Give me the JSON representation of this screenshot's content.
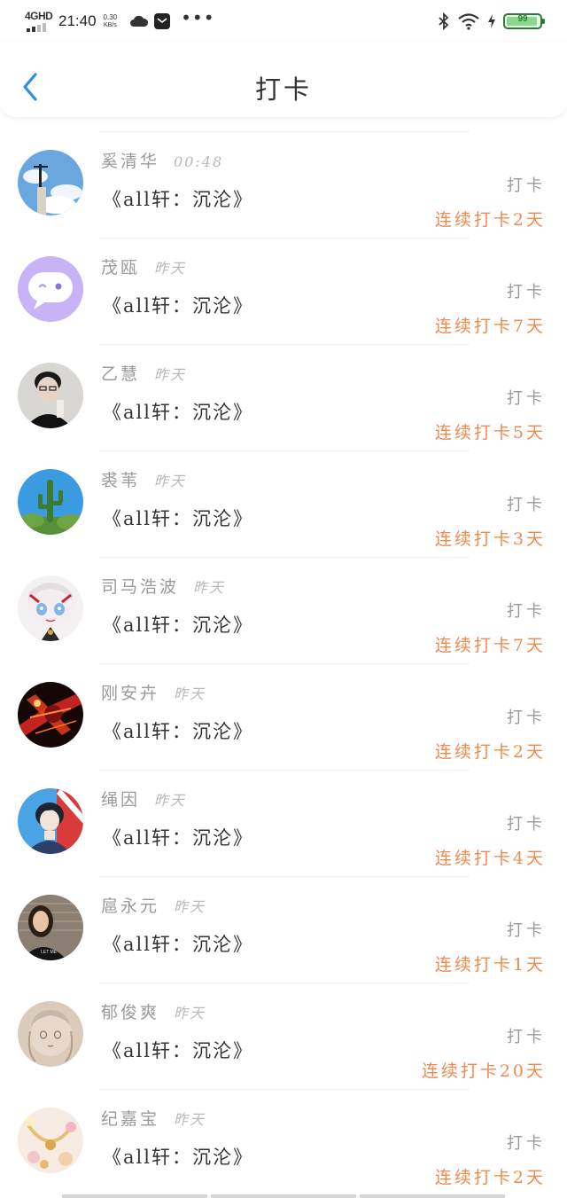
{
  "status_bar": {
    "network": "4GHD",
    "time": "21:40",
    "speed_value": "0.30",
    "speed_unit": "KB/s",
    "battery_text": "99",
    "battery_level": 0.99,
    "icons": [
      "weather-cloud-icon",
      "mail-icon",
      "more-dots-icon",
      "bluetooth-icon",
      "wifi-icon",
      "charging-icon",
      "battery-icon"
    ]
  },
  "header": {
    "title": "打卡",
    "back_icon": "chevron-left-icon"
  },
  "colors": {
    "accent_blue": "#2f8ee0",
    "streak_orange": "#ef8a4f",
    "muted_text": "#9a9a9a"
  },
  "entries": [
    {
      "name": "奚清华",
      "time": "00:48",
      "book": "《all轩：沉沦》",
      "action": "打卡",
      "streak": "连续打卡2天",
      "avatar": "sky-statue-avatar"
    },
    {
      "name": "茂瓯",
      "time": "昨天",
      "book": "《all轩：沉沦》",
      "action": "打卡",
      "streak": "连续打卡7天",
      "avatar": "purple-chat-avatar"
    },
    {
      "name": "乙慧",
      "time": "昨天",
      "book": "《all轩：沉沦》",
      "action": "打卡",
      "streak": "连续打卡5天",
      "avatar": "man-glasses-avatar"
    },
    {
      "name": "裘苇",
      "time": "昨天",
      "book": "《all轩：沉沦》",
      "action": "打卡",
      "streak": "连续打卡3天",
      "avatar": "cactus-avatar"
    },
    {
      "name": "司马浩波",
      "time": "昨天",
      "book": "《all轩：沉沦》",
      "action": "打卡",
      "streak": "连续打卡7天",
      "avatar": "anime-chibi-avatar"
    },
    {
      "name": "刚安卉",
      "time": "昨天",
      "book": "《all轩：沉沦》",
      "action": "打卡",
      "streak": "连续打卡2天",
      "avatar": "red-dark-art-avatar"
    },
    {
      "name": "绳因",
      "time": "昨天",
      "book": "《all轩：沉沦》",
      "action": "打卡",
      "streak": "连续打卡4天",
      "avatar": "anime-boy-avatar"
    },
    {
      "name": "扈永元",
      "time": "昨天",
      "book": "《all轩：沉沦》",
      "action": "打卡",
      "streak": "连续打卡1天",
      "avatar": "woman-portrait-avatar"
    },
    {
      "name": "郁俊爽",
      "time": "昨天",
      "book": "《all轩：沉沦》",
      "action": "打卡",
      "streak": "连续打卡20天",
      "avatar": "sketch-girl-avatar"
    },
    {
      "name": "纪嘉宝",
      "time": "昨天",
      "book": "《all轩：沉沦》",
      "action": "打卡",
      "streak": "连续打卡2天",
      "avatar": "jewelry-avatar"
    }
  ]
}
